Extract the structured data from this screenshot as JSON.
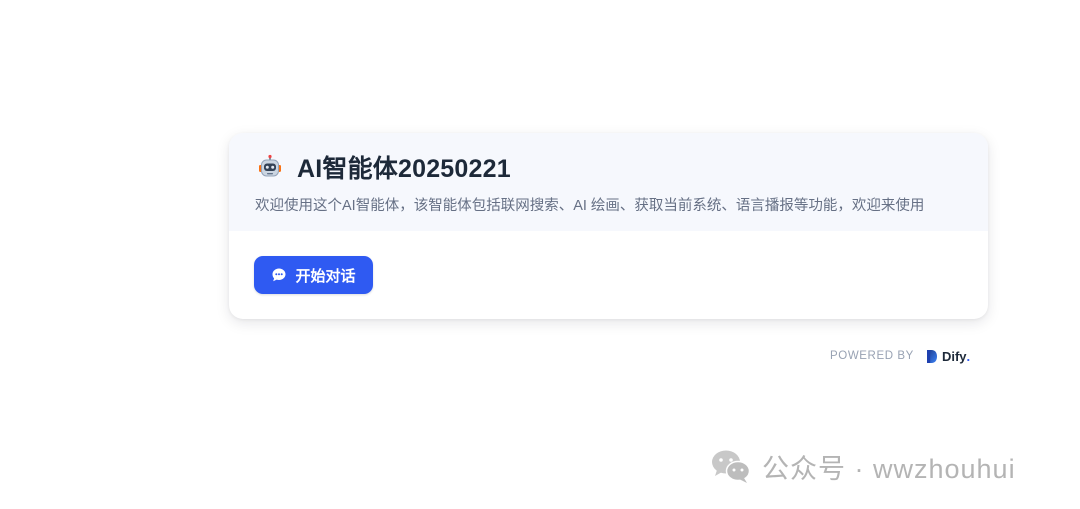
{
  "app": {
    "title": "AI智能体20250221",
    "description": "欢迎使用这个AI智能体，该智能体包括联网搜索、AI 绘画、获取当前系统、语言播报等功能，欢迎来使用",
    "icon": "robot-icon"
  },
  "actions": {
    "start_label": "开始对话",
    "start_icon": "chat-bubble-icon"
  },
  "footer": {
    "powered_label": "POWERED BY",
    "brand": "Dify",
    "brand_suffix": "."
  },
  "watermark": {
    "text": "公众号 · wwzhouhui",
    "icon": "wechat-icon"
  },
  "colors": {
    "primary": "#2f5af2",
    "header_bg": "#f6f8fd",
    "title": "#1d2939",
    "muted": "#667085"
  }
}
